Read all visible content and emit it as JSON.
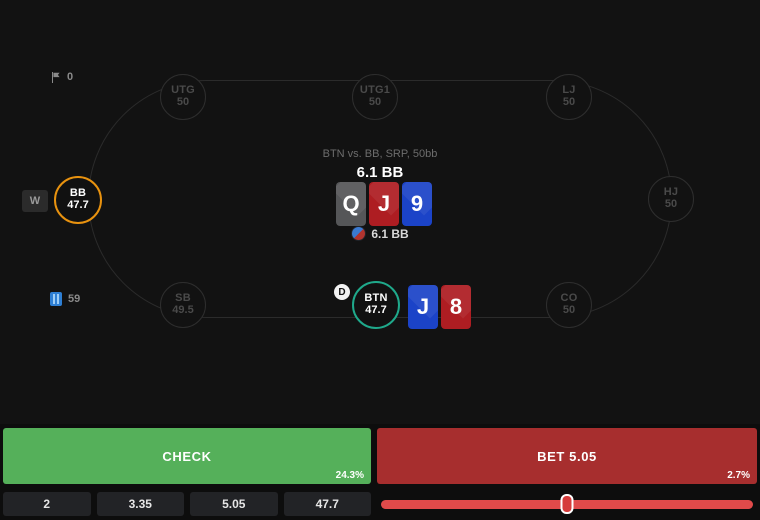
{
  "meta": {
    "accent_green": "#55b05a",
    "accent_red": "#a72e2e",
    "hero_ring": "#1fa98b",
    "villain_ring": "#e8920f",
    "background": "#121212"
  },
  "counters": {
    "flag_icon": "flag-icon",
    "flag_value": "0",
    "hands_icon": "card-stack-icon",
    "hands_value": "59"
  },
  "badges": {
    "dealer": "D",
    "w_badge": "W"
  },
  "spot": {
    "label": "BTN vs. BB, SRP, 50bb",
    "pot_top": "6.1 BB",
    "pot_bottom": "6.1 BB",
    "chip_icon": "poker-chip-icon"
  },
  "seats": [
    {
      "id": "utg",
      "position": "UTG",
      "stack": "50",
      "state": "inactive"
    },
    {
      "id": "utg1",
      "position": "UTG1",
      "stack": "50",
      "state": "inactive"
    },
    {
      "id": "lj",
      "position": "LJ",
      "stack": "50",
      "state": "inactive"
    },
    {
      "id": "hj",
      "position": "HJ",
      "stack": "50",
      "state": "inactive"
    },
    {
      "id": "co",
      "position": "CO",
      "stack": "50",
      "state": "inactive"
    },
    {
      "id": "btn",
      "position": "BTN",
      "stack": "47.7",
      "state": "hero"
    },
    {
      "id": "sb",
      "position": "SB",
      "stack": "49.5",
      "state": "inactive"
    },
    {
      "id": "bb",
      "position": "BB",
      "stack": "47.7",
      "state": "villain"
    }
  ],
  "board": [
    {
      "rank": "Q",
      "suit": "s"
    },
    {
      "rank": "J",
      "suit": "h"
    },
    {
      "rank": "9",
      "suit": "d"
    }
  ],
  "hero_hand": [
    {
      "rank": "J",
      "suit": "d"
    },
    {
      "rank": "8",
      "suit": "h"
    }
  ],
  "actions": [
    {
      "id": "check",
      "label": "CHECK",
      "frequency": "24.3%",
      "kind": "check"
    },
    {
      "id": "bet",
      "label": "BET 5.05",
      "frequency": "2.7%",
      "kind": "bet"
    }
  ],
  "bet_sizes": [
    "2",
    "3.35",
    "5.05",
    "47.7"
  ],
  "slider": {
    "value_percent": 50
  }
}
